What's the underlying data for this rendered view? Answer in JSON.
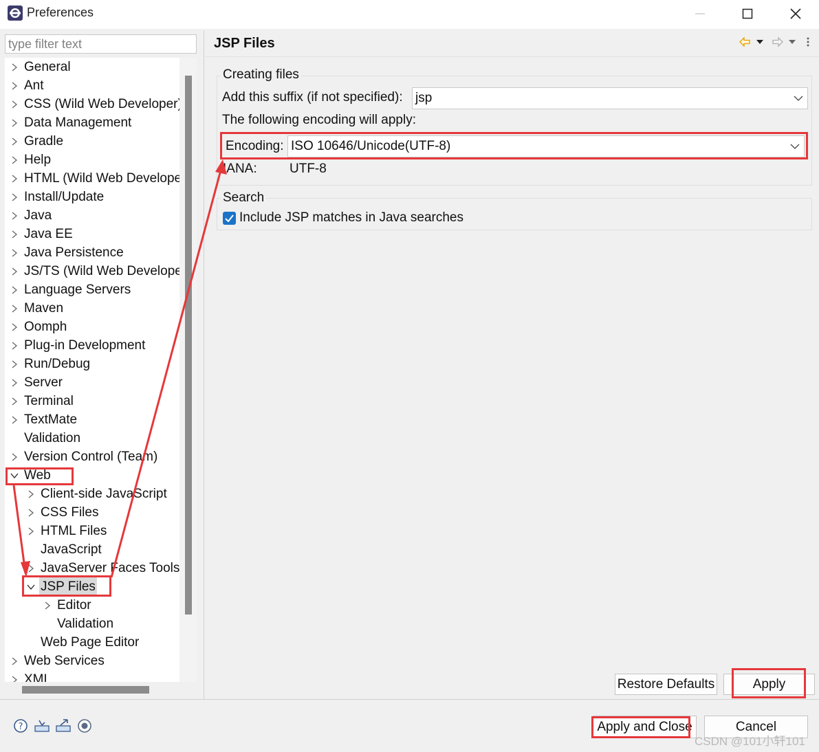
{
  "window": {
    "title": "Preferences",
    "controls": [
      "minimize",
      "maximize",
      "close"
    ]
  },
  "filter": {
    "placeholder": "type filter text",
    "value": ""
  },
  "tree": {
    "items": [
      {
        "label": "General",
        "expander": "collapsed",
        "level": 0
      },
      {
        "label": "Ant",
        "expander": "collapsed",
        "level": 0
      },
      {
        "label": "CSS (Wild Web Developer)",
        "expander": "collapsed",
        "level": 0
      },
      {
        "label": "Data Management",
        "expander": "collapsed",
        "level": 0
      },
      {
        "label": "Gradle",
        "expander": "collapsed",
        "level": 0
      },
      {
        "label": "Help",
        "expander": "collapsed",
        "level": 0
      },
      {
        "label": "HTML (Wild Web Develope",
        "expander": "collapsed",
        "level": 0
      },
      {
        "label": "Install/Update",
        "expander": "collapsed",
        "level": 0
      },
      {
        "label": "Java",
        "expander": "collapsed",
        "level": 0
      },
      {
        "label": "Java EE",
        "expander": "collapsed",
        "level": 0
      },
      {
        "label": "Java Persistence",
        "expander": "collapsed",
        "level": 0
      },
      {
        "label": "JS/TS (Wild Web Develope",
        "expander": "collapsed",
        "level": 0
      },
      {
        "label": "Language Servers",
        "expander": "collapsed",
        "level": 0
      },
      {
        "label": "Maven",
        "expander": "collapsed",
        "level": 0
      },
      {
        "label": "Oomph",
        "expander": "collapsed",
        "level": 0
      },
      {
        "label": "Plug-in Development",
        "expander": "collapsed",
        "level": 0
      },
      {
        "label": "Run/Debug",
        "expander": "collapsed",
        "level": 0
      },
      {
        "label": "Server",
        "expander": "collapsed",
        "level": 0
      },
      {
        "label": "Terminal",
        "expander": "collapsed",
        "level": 0
      },
      {
        "label": "TextMate",
        "expander": "collapsed",
        "level": 0
      },
      {
        "label": "Validation",
        "expander": "none",
        "level": 0
      },
      {
        "label": "Version Control (Team)",
        "expander": "collapsed",
        "level": 0
      },
      {
        "label": "Web",
        "expander": "expanded",
        "level": 0
      },
      {
        "label": "Client-side JavaScript",
        "expander": "collapsed",
        "level": 1
      },
      {
        "label": "CSS Files",
        "expander": "collapsed",
        "level": 1
      },
      {
        "label": "HTML Files",
        "expander": "collapsed",
        "level": 1
      },
      {
        "label": "JavaScript",
        "expander": "none",
        "level": 1
      },
      {
        "label": "JavaServer Faces Tools",
        "expander": "collapsed",
        "level": 1
      },
      {
        "label": "JSP Files",
        "expander": "expanded",
        "level": 1,
        "selected": true
      },
      {
        "label": "Editor",
        "expander": "collapsed",
        "level": 2
      },
      {
        "label": "Validation",
        "expander": "none",
        "level": 2
      },
      {
        "label": "Web Page Editor",
        "expander": "none",
        "level": 1
      },
      {
        "label": "Web Services",
        "expander": "collapsed",
        "level": 0
      },
      {
        "label": "XML",
        "expander": "collapsed",
        "level": 0
      }
    ]
  },
  "page": {
    "title": "JSP Files",
    "creating_files": {
      "group_label": "Creating files",
      "suffix_label": "Add this suffix (if not specified):",
      "suffix_value": "jsp",
      "encoding_note": "The following encoding will apply:",
      "encoding_label": "Encoding:",
      "encoding_value": "ISO 10646/Unicode(UTF-8)",
      "iana_label": "IANA:",
      "iana_value": "UTF-8"
    },
    "search": {
      "group_label": "Search",
      "checkbox_label": "Include JSP matches in Java searches",
      "checked": true
    },
    "restore_defaults_label": "Restore Defaults",
    "apply_label": "Apply"
  },
  "footer": {
    "apply_close_label": "Apply and Close",
    "cancel_label": "Cancel",
    "icons": [
      "help-icon",
      "import-icon",
      "export-icon",
      "record-icon"
    ]
  },
  "watermark": "CSDN @101小轩101",
  "colors": {
    "annotation": "#e5383b",
    "checkbox": "#1a73c9",
    "accent_icon": "#e6a100"
  }
}
